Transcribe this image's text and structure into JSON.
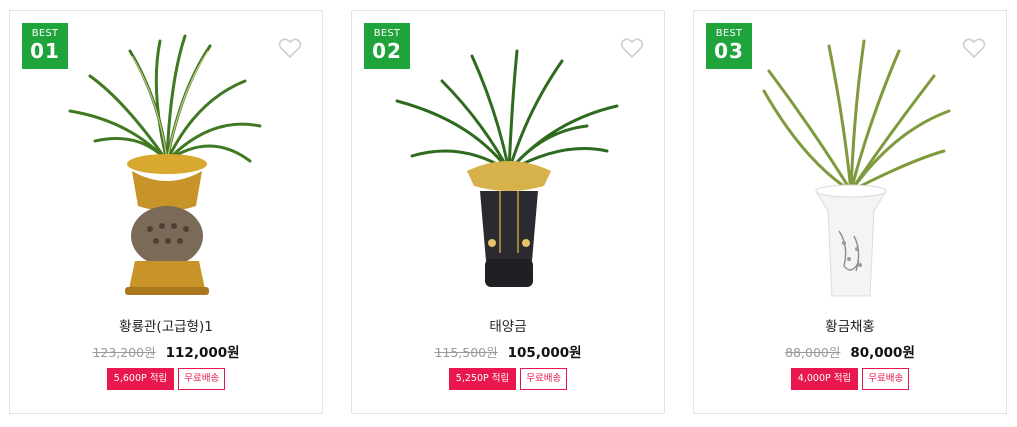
{
  "colors": {
    "badge": "#1fa33b",
    "accent": "#e8174e"
  },
  "products": [
    {
      "badge_label": "BEST",
      "badge_rank": "01",
      "name": "황룡관(고급형)1",
      "original_price": "123,200원",
      "sale_price": "112,000원",
      "points": "5,600P 적립",
      "shipping": "무료배송"
    },
    {
      "badge_label": "BEST",
      "badge_rank": "02",
      "name": "태양금",
      "original_price": "115,500원",
      "sale_price": "105,000원",
      "points": "5,250P 적립",
      "shipping": "무료배송"
    },
    {
      "badge_label": "BEST",
      "badge_rank": "03",
      "name": "황금채홍",
      "original_price": "88,000원",
      "sale_price": "80,000원",
      "points": "4,000P 적립",
      "shipping": "무료배송"
    }
  ]
}
